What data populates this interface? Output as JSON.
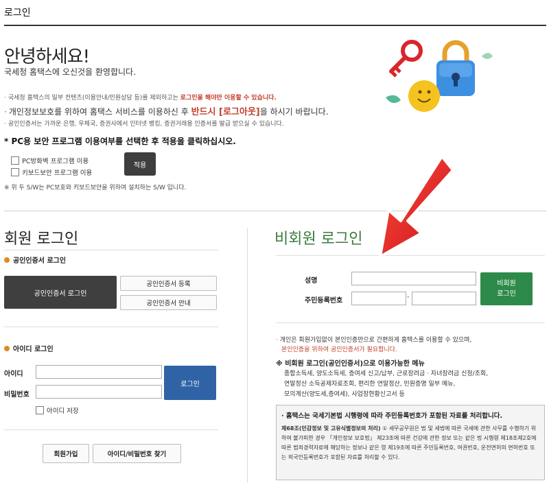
{
  "page_title": "로그인",
  "greeting": {
    "title": "안녕하세요!",
    "subtitle": "국세청 홈택스에 오신것을 환영합니다."
  },
  "notices": {
    "n1_pre": "국세청 홈택스의 일부 컨텐츠(이용안내/민원상담 등)를 제외하고는 ",
    "n1_red": "로그인을 해야만 이용할 수 있습니다.",
    "n2_pre": "개인정보보호를 위하여 홈택스 서비스를 이용하신 후 ",
    "n2_red": "반드시 [로그아웃]",
    "n2_post": "을 하시기 바랍니다.",
    "n3": "공인인증서는 가까운 은행, 우체국, 증권사에서 인터넷 뱅킹, 증권거래용 인증서를 발급 받으실 수 있습니다."
  },
  "security": {
    "heading": "* PC용 보안 프로그램 이용여부를 선택한 후 적용을 클릭하십시오.",
    "option1": "PC방화벽 프로그램 이용",
    "option2": "키보드보안 프로그램 이용",
    "apply_label": "적용",
    "note": "※ 위 두 S/W는 PC보호와 키보드보안을 위하여 설치하는 S/W 입니다."
  },
  "member": {
    "title": "회원 로그인",
    "cert_section": "공인인증서 로그인",
    "cert_login_button": "공인인증서 로그인",
    "cert_register_button": "공인인증서 등록",
    "cert_guide_button": "공인인증서 안내",
    "id_section": "아이디 로그인",
    "id_label": "아이디",
    "pw_label": "비밀번호",
    "id_value": "",
    "pw_value": "",
    "login_button": "로그인",
    "save_id_label": "아이디 저장",
    "join_button": "회원가입",
    "find_button": "아이디/비밀번호 찾기"
  },
  "guest": {
    "title": "비회원 로그인",
    "name_label": "성명",
    "rrn_label": "주민등록번호",
    "name_value": "",
    "rrn_front_value": "",
    "rrn_back_value": "",
    "rrn_dash": "-",
    "login_button_line1": "비회원",
    "login_button_line2": "로그인",
    "desc1": "개인은 회원가입없이 본인인증만으로 간편하게 홈택스를 이용할 수 있으며,",
    "desc2": "본인인증을 위하여 공인인증서가 필요합니다.",
    "menu_heading": "※ 비회원 로그인(공인인증서)으로 이용가능한 메뉴",
    "menu_line1": "종합소득세, 양도소득세, 증여세 신고/납부, 근로장려금 · 자녀장려금 신청/조회,",
    "menu_line2": "연말정산 소득공제자료조회, 편리한 연말정산, 민원증명 일부 메뉴,",
    "menu_line3": "모의계산(양도세,증여세), 사업장현황신고서 등",
    "info_heading": "· 홈택스는 국세기본법 시행령에 따라 주민등록번호가 포함된 자료를 처리합니다.",
    "info_bold": "제68조(민감정보 및 고유식별정보의 처리)",
    "info_body": " ① 세무공무원은 법 및 세법에 따른 국세에 관한 사무를 수행하기 위하여 불가피한 경우 「개인정보 보호법」 제23조에 따른 건강에 관한 정보 또는 같은 법 시행령 제18조제2호에 따른 범죄경력자료에 해당하는 정보나 같은 영 제19조에 따른 주민등록번호, 여권번호, 운전면허의 면허번호 또는 외국인등록번호가 포함된 자료를 처리할 수 있다."
  },
  "colors": {
    "accent_red": "#c2402b",
    "guest_green": "#2d8a4a",
    "member_blue": "#2f63a6",
    "dark_button": "#3f3f3f",
    "arrow_red": "#e21f1f"
  },
  "icons": [
    "key-icon",
    "padlock-icon",
    "smiley-icon",
    "leaf-icon",
    "arrow-graphic"
  ]
}
